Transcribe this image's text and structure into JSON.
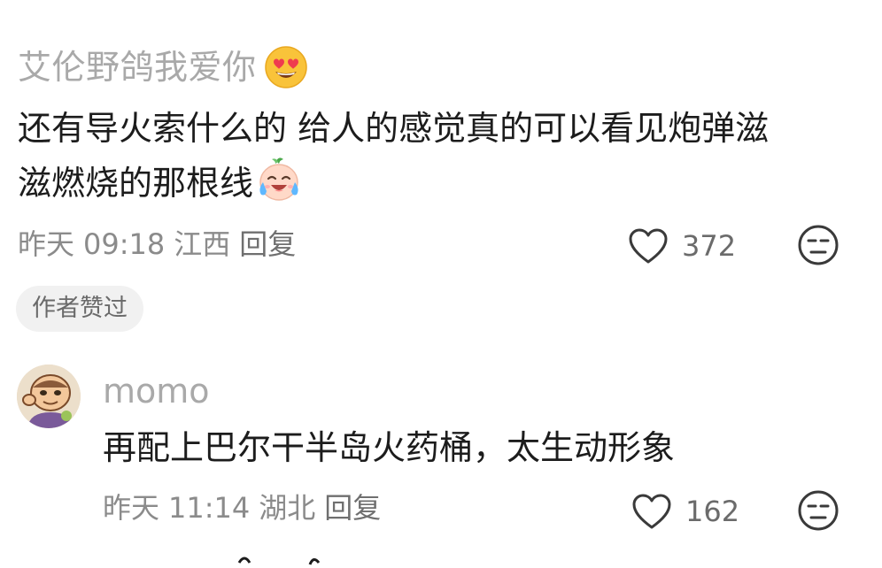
{
  "comments": [
    {
      "username": "艾伦野鸽我爱你",
      "username_emoji": "heart-eyes-emoji",
      "text_line1": "还有导火索什么的 给人的感觉真的可以看见炮弹滋",
      "text_line2": "滋燃烧的那根线",
      "text_emoji": "laughing-crying-emoji",
      "date": "昨天",
      "time": "09:18",
      "location": "江西",
      "reply_label": "回复",
      "like_count": "372",
      "author_badge": "作者赞过"
    },
    {
      "username": "momo",
      "text": "再配上巴尔干半岛火药桶，太生动形象",
      "date": "昨天",
      "time": "11:14",
      "location": "湖北",
      "reply_label": "回复",
      "like_count": "162"
    }
  ],
  "icons": {
    "like": "heart-outline-icon",
    "react": "unamused-face-icon"
  },
  "colors": {
    "username": "#a9a9a9",
    "body_text": "#1c1c1c",
    "meta_text": "#8b8b8b",
    "badge_bg": "#f1f1f1"
  }
}
